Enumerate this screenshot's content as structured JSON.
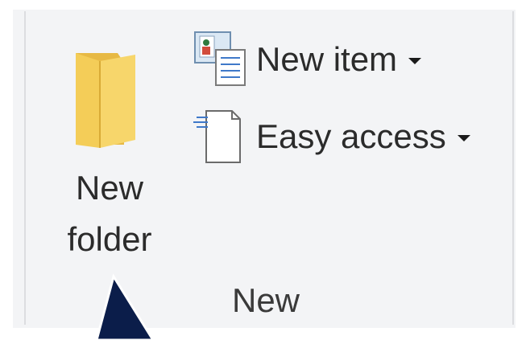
{
  "ribbon": {
    "group_label": "New",
    "new_folder": {
      "label_line1": "New",
      "label_line2": "folder",
      "icon": "folder-icon"
    },
    "new_item": {
      "label": "New item",
      "icon": "new-item-icon"
    },
    "easy_access": {
      "label": "Easy access",
      "icon": "easy-access-icon"
    }
  },
  "colors": {
    "background": "#f3f4f6",
    "text": "#2b2b2b",
    "folder": "#f7d66b",
    "cursor": "#0b1d4a"
  }
}
